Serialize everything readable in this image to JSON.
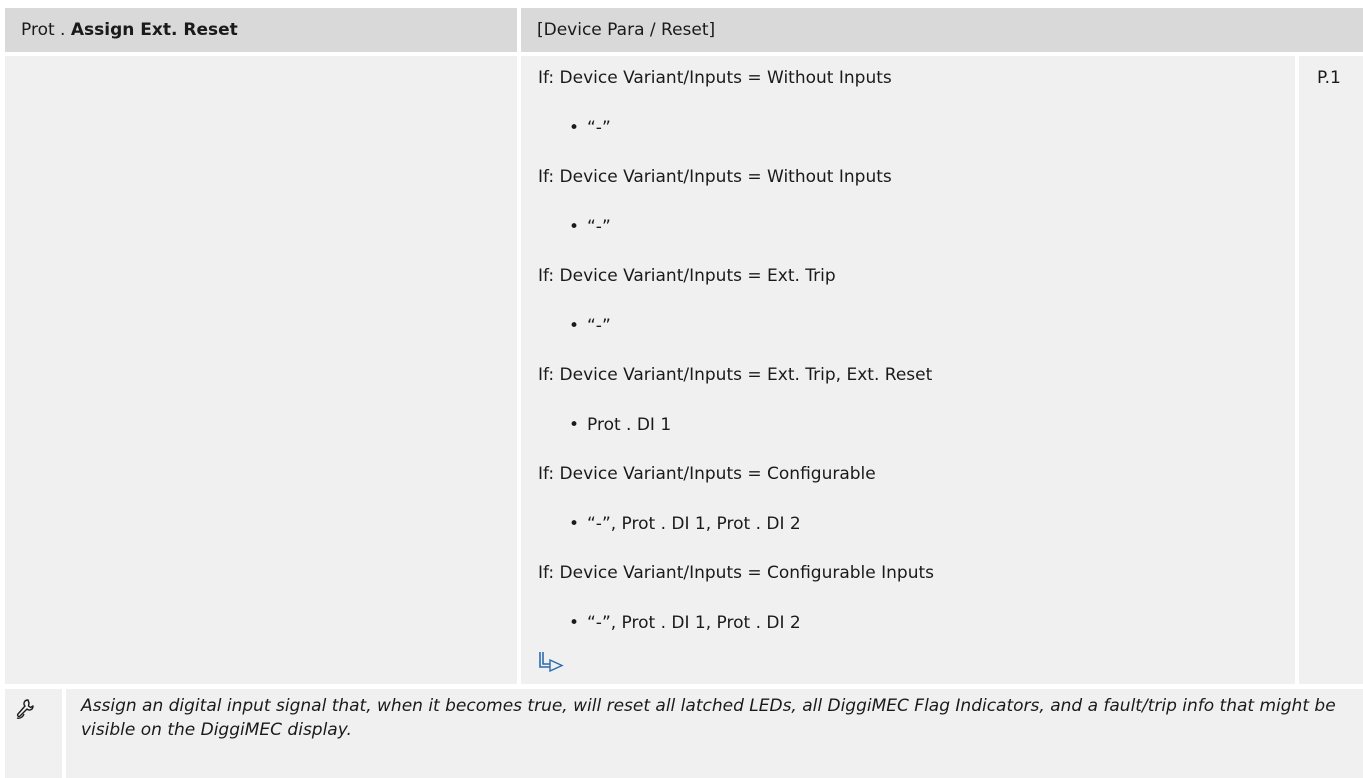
{
  "header": {
    "prefix": "Prot . ",
    "title": "Assign Ext. Reset",
    "path": "[Device Para / Reset]"
  },
  "page_ref": "P.1",
  "conditions": [
    {
      "condition": "If: Device Variant/Inputs = Without Inputs",
      "value": "“-”"
    },
    {
      "condition": "If: Device Variant/Inputs = Without Inputs",
      "value": "“-”"
    },
    {
      "condition": "If: Device Variant/Inputs = Ext. Trip",
      "value": "“-”"
    },
    {
      "condition": "If: Device Variant/Inputs = Ext. Trip, Ext. Reset",
      "value": "Prot . DI 1"
    },
    {
      "condition": "If: Device Variant/Inputs = Configurable",
      "value": "“-”, Prot . DI 1, Prot . DI 2"
    },
    {
      "condition": "If: Device Variant/Inputs = Configurable Inputs",
      "value": "“-”, Prot . DI 1, Prot . DI 2"
    }
  ],
  "note": "Assign an digital input signal that, when it becomes true, will reset all latched LEDs, all DiggiMEC Flag Indicators, and a fault/trip info that might be visible on the DiggiMEC display.",
  "icons": {
    "link": "arrow-link-icon",
    "note": "wrench-hand-icon"
  },
  "colors": {
    "header_bg": "#d9d9d9",
    "cell_bg": "#f0f0f0",
    "link_blue": "#2b6cb0"
  }
}
